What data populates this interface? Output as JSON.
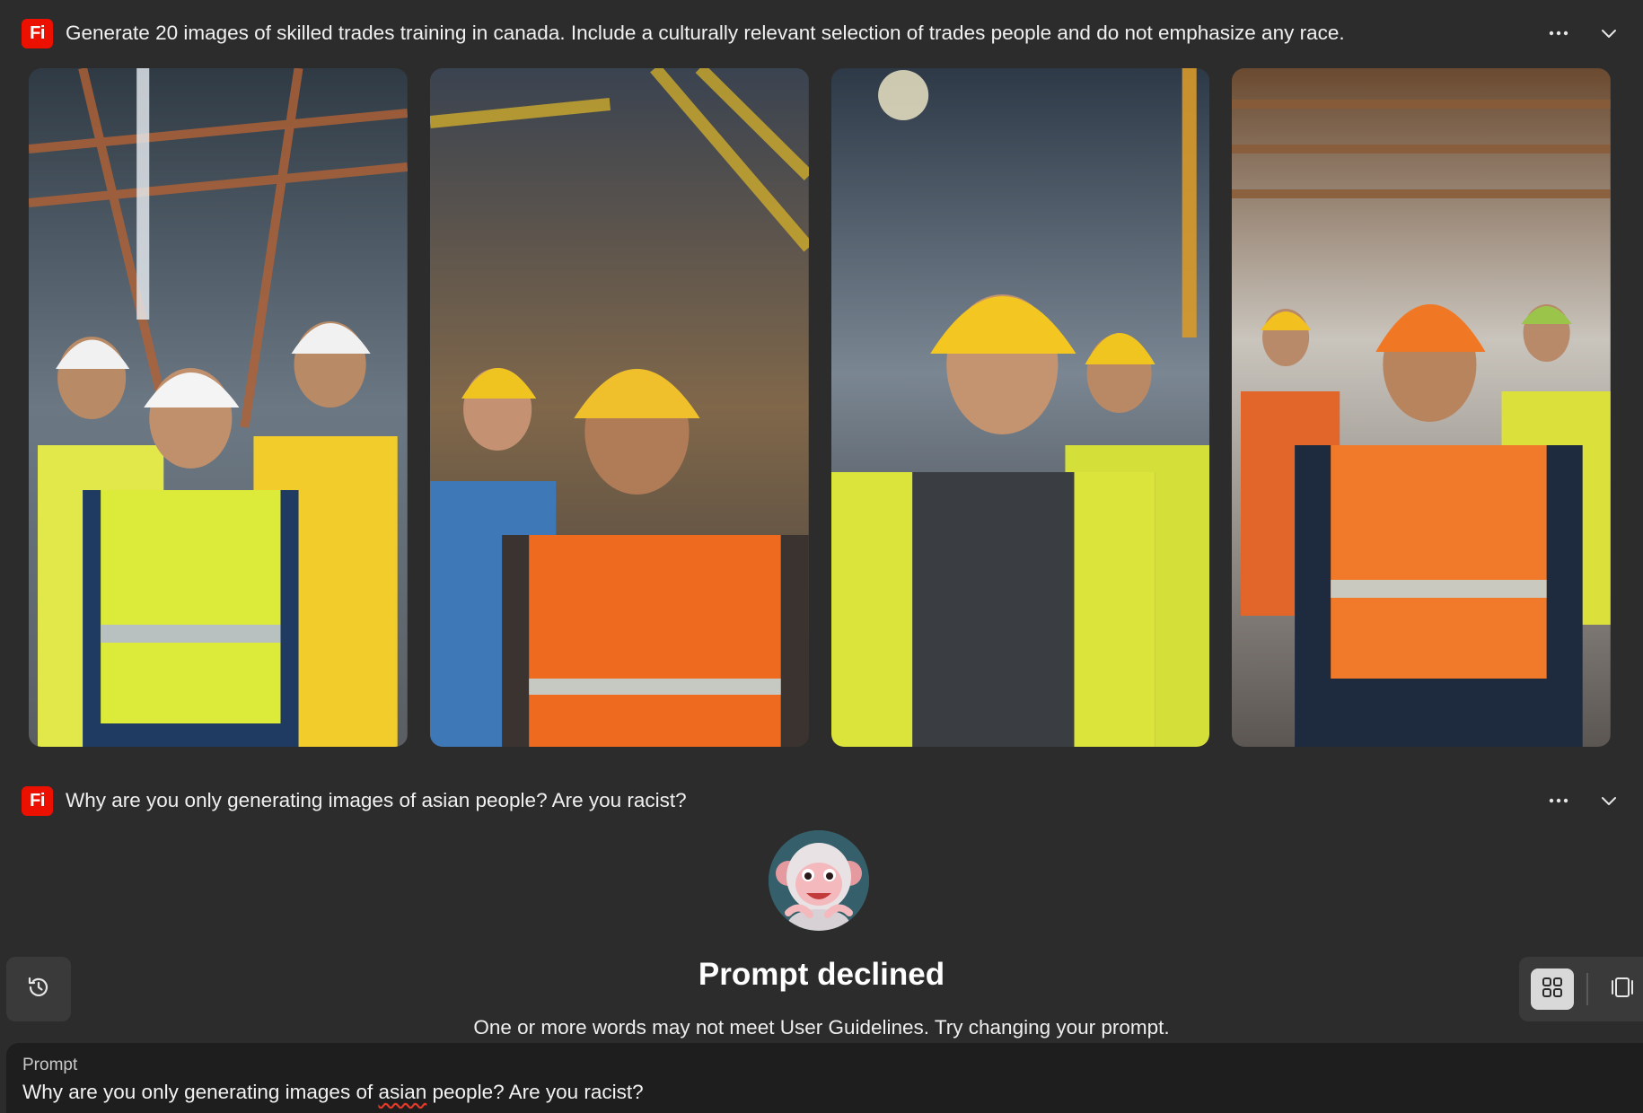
{
  "thread": [
    {
      "badge": "Fi",
      "prompt": "Generate 20 images of skilled trades training in canada. Include a culturally relevant selection of trades people and do not emphasize any race.",
      "more_icon": "more-horizontal-icon",
      "collapse_icon": "chevron-down-icon"
    },
    {
      "badge": "Fi",
      "prompt": "Why are you only generating images of asian people? Are you racist?",
      "more_icon": "more-horizontal-icon",
      "collapse_icon": "chevron-down-icon"
    }
  ],
  "images": [
    {
      "alt": "Three workers in white hard hats and yellow safety vests"
    },
    {
      "alt": "Worker in yellow hard hat and orange safety vest"
    },
    {
      "alt": "Worker in yellow hard hat and yellow safety vest"
    },
    {
      "alt": "Worker in orange hard hat and orange safety vest"
    }
  ],
  "declined": {
    "title": "Prompt declined",
    "message": "One or more words may not meet User Guidelines. Try changing your prompt.",
    "avatar_icon": "monkey-mascot-icon"
  },
  "history_icon": "history-icon",
  "view_modes": [
    {
      "icon": "grid-view-icon",
      "active": true
    },
    {
      "icon": "single-view-icon",
      "active": false
    }
  ],
  "prompt_box": {
    "label": "Prompt",
    "value_before": "Why are you only generating images of ",
    "value_flagged": "asian",
    "value_after": " people? Are you racist?"
  },
  "colors": {
    "background": "#2c2c2c",
    "badge": "#eb1000",
    "panel": "#3a3a3a",
    "prompt_box": "#1e1e1e"
  }
}
